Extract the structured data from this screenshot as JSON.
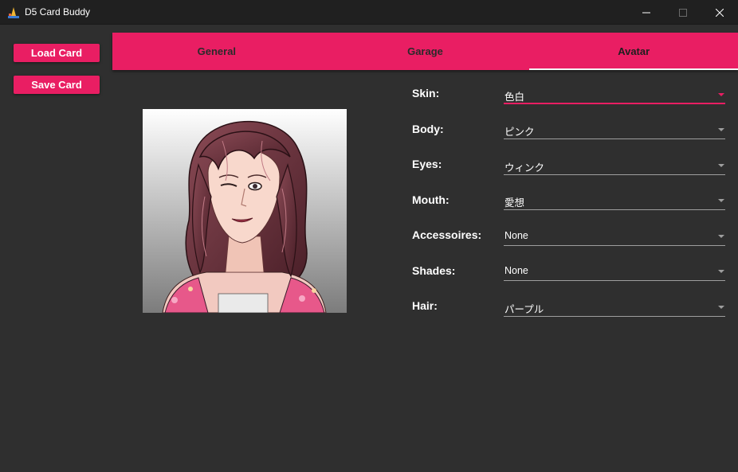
{
  "window": {
    "title": "D5 Card Buddy",
    "icon": "app-logo-icon"
  },
  "sidebar": {
    "load_label": "Load Card",
    "save_label": "Save Card"
  },
  "tabs": [
    {
      "label": "General",
      "active": false
    },
    {
      "label": "Garage",
      "active": false
    },
    {
      "label": "Avatar",
      "active": true
    }
  ],
  "colors": {
    "accent": "#e91e63",
    "background": "#2f2f2f",
    "titlebar": "#202020"
  },
  "avatar": {
    "fields": [
      {
        "label": "Skin:",
        "value": "色白",
        "focused": true
      },
      {
        "label": "Body:",
        "value": "ピンク"
      },
      {
        "label": "Eyes:",
        "value": "ウィンク"
      },
      {
        "label": "Mouth:",
        "value": "愛想"
      },
      {
        "label": "Accessoires:",
        "value": "None"
      },
      {
        "label": "Shades:",
        "value": "None"
      },
      {
        "label": "Hair:",
        "value": "パープル"
      }
    ]
  }
}
